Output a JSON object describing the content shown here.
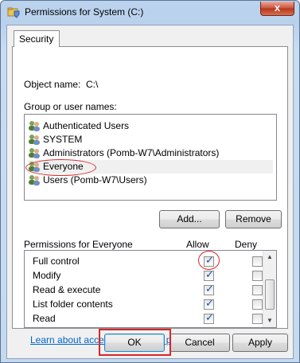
{
  "window": {
    "title": "Permissions for System (C:)",
    "close_glyph": "x",
    "title_icon": "folder-shield-icon"
  },
  "tabs": [
    {
      "label": "Security"
    }
  ],
  "object": {
    "label": "Object name:",
    "value": "C:\\"
  },
  "groups": {
    "label": "Group or user names:",
    "items": [
      {
        "name": "Authenticated Users"
      },
      {
        "name": "SYSTEM"
      },
      {
        "name": "Administrators (Pomb-W7\\Administrators)"
      },
      {
        "name": "Everyone",
        "selected": true
      },
      {
        "name": "Users (Pomb-W7\\Users)"
      }
    ]
  },
  "buttons": {
    "add": "Add...",
    "remove": "Remove",
    "ok": "OK",
    "cancel": "Cancel",
    "apply": "Apply"
  },
  "permissions": {
    "label": "Permissions for Everyone",
    "allow_label": "Allow",
    "deny_label": "Deny",
    "rows": [
      {
        "name": "Full control",
        "allow": true,
        "deny": false
      },
      {
        "name": "Modify",
        "allow": true,
        "deny": false
      },
      {
        "name": "Read & execute",
        "allow": true,
        "deny": false
      },
      {
        "name": "List folder contents",
        "allow": true,
        "deny": false
      },
      {
        "name": "Read",
        "allow": true,
        "deny": false
      }
    ]
  },
  "link": "Learn about access control and permissions",
  "colors": {
    "highlight": "#d9262a",
    "link": "#0066cc",
    "titlebar": "#b9d1ec"
  }
}
